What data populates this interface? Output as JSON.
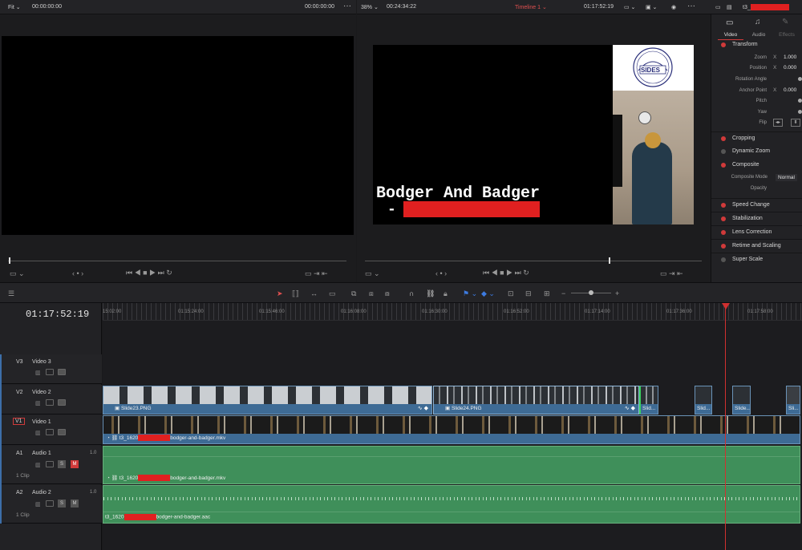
{
  "left_viewer": {
    "fit_label": "Fit",
    "timecode_left": "00:00:00:00",
    "timecode_right": "00:00:00:00"
  },
  "right_viewer": {
    "zoom": "38%",
    "duration": "00:24:34:22",
    "timeline_name": "Timeline 1",
    "timecode": "01:17:52:19",
    "overlay_title": "Bodger And Badger",
    "overlay_dash": "-",
    "logo_text": "SIDES"
  },
  "inspector": {
    "clip_name": "t3_",
    "tabs": [
      "Video",
      "Audio",
      "Effects"
    ],
    "transform_label": "Transform",
    "props": [
      {
        "label": "Zoom",
        "axis": "X",
        "value": "1.000"
      },
      {
        "label": "Position",
        "axis": "X",
        "value": "0.000"
      },
      {
        "label": "Rotation Angle",
        "axis": "",
        "value": ""
      },
      {
        "label": "Anchor Point",
        "axis": "X",
        "value": "0.000"
      },
      {
        "label": "Pitch",
        "axis": "",
        "value": ""
      },
      {
        "label": "Yaw",
        "axis": "",
        "value": ""
      },
      {
        "label": "Flip",
        "axis": "",
        "value": ""
      }
    ],
    "sections": [
      "Cropping",
      "Dynamic Zoom",
      "Composite"
    ],
    "composite_mode_label": "Composite Mode",
    "composite_mode_value": "Normal",
    "opacity_label": "Opacity",
    "sections2": [
      "Speed Change",
      "Stabilization",
      "Lens Correction",
      "Retime and Scaling",
      "Super Scale"
    ]
  },
  "timeline": {
    "timecode": "01:17:52:19",
    "ruler": [
      "15:02:00",
      "01:15:24:00",
      "01:15:46:00",
      "01:16:08:00",
      "01:16:30:00",
      "01:16:52:00",
      "01:17:14:00",
      "01:17:36:00",
      "01:17:58:00"
    ],
    "tracks": [
      {
        "id": "V3",
        "name": "Video 3"
      },
      {
        "id": "V2",
        "name": "Video 2"
      },
      {
        "id": "V1",
        "name": "Video 1"
      },
      {
        "id": "A1",
        "name": "Audio 1",
        "level": "1.0",
        "clips": "1 Clip"
      },
      {
        "id": "A2",
        "name": "Audio 2",
        "level": "1.0",
        "clips": "1 Clip"
      }
    ],
    "v2_clips": [
      "Slide23.PNG",
      "Slide24.PNG",
      "Slid...",
      "Slid...",
      "Slide...",
      "Sli..."
    ],
    "v1_clip_prefix": "t3_1620",
    "v1_clip_suffix": "bodger-and-badger.mkv",
    "a1_clip_prefix": "t3_1620",
    "a1_clip_suffix": "bodger-and-badger.mkv",
    "a2_clip_prefix": "t3_1620",
    "a2_clip_suffix": "bodger-and-badger.aac",
    "solo_label": "S",
    "mute_label": "M"
  }
}
